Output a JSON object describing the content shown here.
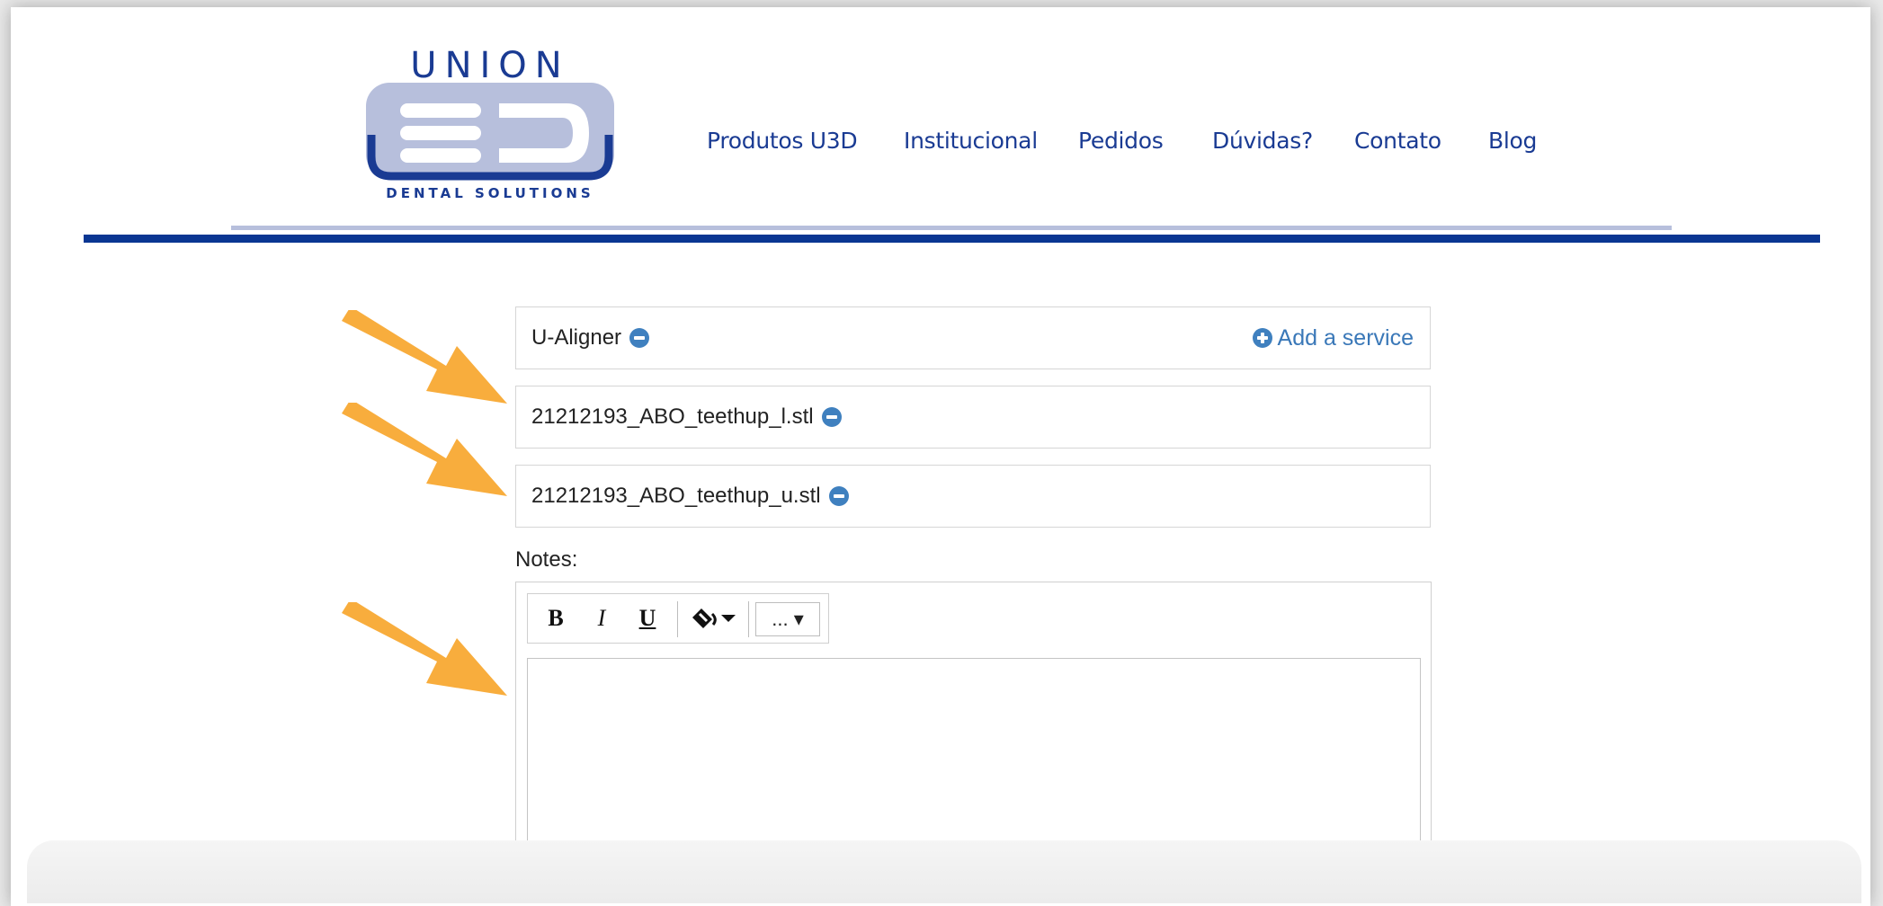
{
  "brand": {
    "name": "UNION",
    "mark": "3D",
    "tagline": "DENTAL SOLUTIONS",
    "primary_color": "#1a3b93",
    "accent_color": "#b7bfdc"
  },
  "nav": {
    "items": [
      {
        "label": "Produtos U3D"
      },
      {
        "label": "Institucional"
      },
      {
        "label": "Pedidos"
      },
      {
        "label": "Dúvidas?"
      },
      {
        "label": "Contato"
      },
      {
        "label": "Blog"
      }
    ]
  },
  "service": {
    "name": "U-Aligner",
    "add_label": "Add a service"
  },
  "files": [
    {
      "name": "21212193_ABO_teethup_l.stl"
    },
    {
      "name": "21212193_ABO_teethup_u.stl"
    }
  ],
  "notes": {
    "label": "Notes:",
    "toolbar": {
      "bold": "B",
      "italic": "I",
      "underline": "U",
      "more": "... ▾"
    },
    "value": ""
  },
  "annotation_color": "#f8ad3d"
}
